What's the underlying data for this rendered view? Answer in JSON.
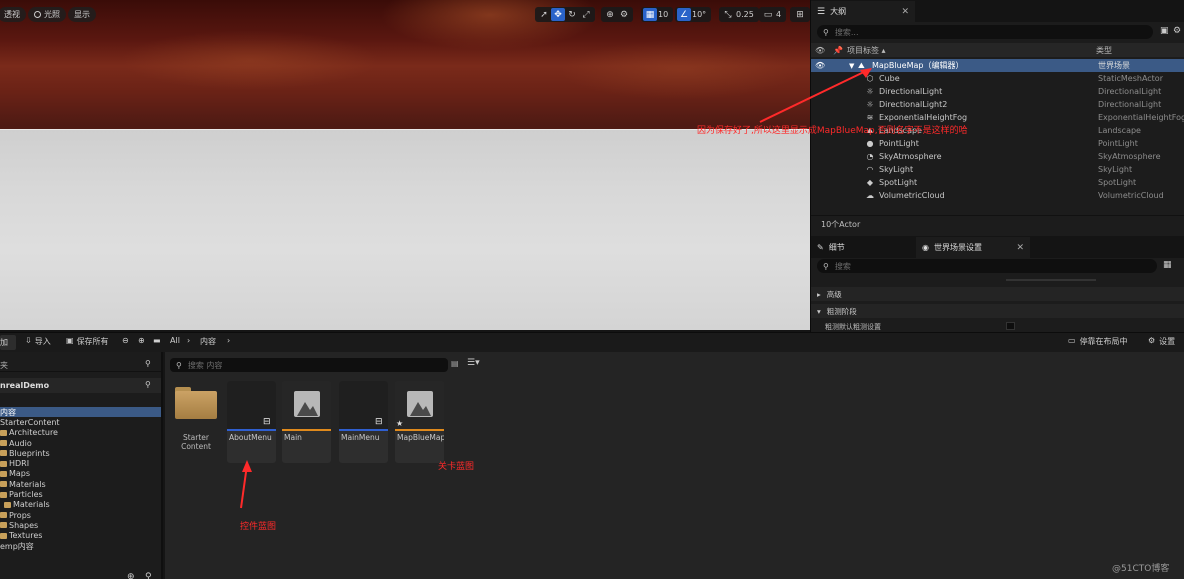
{
  "viewport": {
    "buttons": [
      {
        "label": "透视"
      },
      {
        "label": "光照",
        "icon": "light-icon"
      },
      {
        "label": "显示"
      }
    ],
    "grid_snap": "10",
    "rotation_snap": "10°",
    "scale_snap": "0.25",
    "camera_speed": "4"
  },
  "outliner": {
    "tab_label": "大纲",
    "search_placeholder": "搜索...",
    "col_label": "项目标签",
    "col_type": "类型",
    "root": {
      "name": "MapBlueMap（编辑器）",
      "type": "世界场景"
    },
    "actors": [
      {
        "name": "Cube",
        "type": "StaticMeshActor",
        "icon": "cube-icon"
      },
      {
        "name": "DirectionalLight",
        "type": "DirectionalLight",
        "icon": "sun-icon"
      },
      {
        "name": "DirectionalLight2",
        "type": "DirectionalLight",
        "icon": "sun-icon"
      },
      {
        "name": "ExponentialHeightFog",
        "type": "ExponentialHeightFog",
        "icon": "fog-icon"
      },
      {
        "name": "Landscape",
        "type": "Landscape",
        "icon": "landscape-icon"
      },
      {
        "name": "PointLight",
        "type": "PointLight",
        "icon": "bulb-icon"
      },
      {
        "name": "SkyAtmosphere",
        "type": "SkyAtmosphere",
        "icon": "atmosphere-icon"
      },
      {
        "name": "SkyLight",
        "type": "SkyLight",
        "icon": "skylight-icon"
      },
      {
        "name": "SpotLight",
        "type": "SpotLight",
        "icon": "spotlight-icon"
      },
      {
        "name": "VolumetricCloud",
        "type": "VolumetricCloud",
        "icon": "cloud-icon"
      }
    ],
    "actor_count": "10个Actor"
  },
  "details": {
    "tab_details": "细节",
    "tab_world": "世界场景设置",
    "search_placeholder": "搜索",
    "section_advanced": "高级",
    "section_precompute": "粗测阶段",
    "row_default": "粗测默认粗测设置"
  },
  "content_browser": {
    "add_label": "加",
    "import_label": "导入",
    "save_all_label": "保存所有",
    "path": [
      "All",
      "内容"
    ],
    "dock_label": "停靠在布局中",
    "settings_label": "设置",
    "left_search_placeholder": "夹",
    "project_name": "nrealDemo",
    "folders": [
      {
        "name": "内容"
      },
      {
        "name": "StarterContent"
      },
      {
        "name": "Architecture"
      },
      {
        "name": "Audio"
      },
      {
        "name": "Blueprints"
      },
      {
        "name": "HDRI"
      },
      {
        "name": "Maps"
      },
      {
        "name": "Materials"
      },
      {
        "name": "Particles"
      },
      {
        "name": "Materials"
      },
      {
        "name": "Props"
      },
      {
        "name": "Shapes"
      },
      {
        "name": "Textures"
      },
      {
        "name": "emp内容"
      }
    ],
    "search_placeholder": "搜索 内容",
    "assets": [
      {
        "label": "Starter\nContent",
        "kind": "folder"
      },
      {
        "label": "AboutMenu",
        "kind": "widget",
        "bar_color": "#2f5fd0"
      },
      {
        "label": "Main",
        "kind": "level",
        "bar_color": "#e08a1c"
      },
      {
        "label": "MainMenu",
        "kind": "widget",
        "bar_color": "#2f5fd0"
      },
      {
        "label": "MapBlueMap",
        "kind": "level",
        "bar_color": "#e08a1c"
      }
    ]
  },
  "annotations": {
    "saved_note": "因为保存好了,所以这里显示成MapBlueMap,否则名字不是这样的哈",
    "level_bp": "关卡蓝图",
    "widget_bp": "控件蓝图"
  },
  "watermark": "@51CTO博客",
  "colors": {
    "selection": "#3b5a86",
    "accent_blue": "#2a63c9",
    "annotation_red": "#ff2a2a",
    "level_bar": "#e08a1c",
    "widget_bar": "#2f5fd0"
  }
}
